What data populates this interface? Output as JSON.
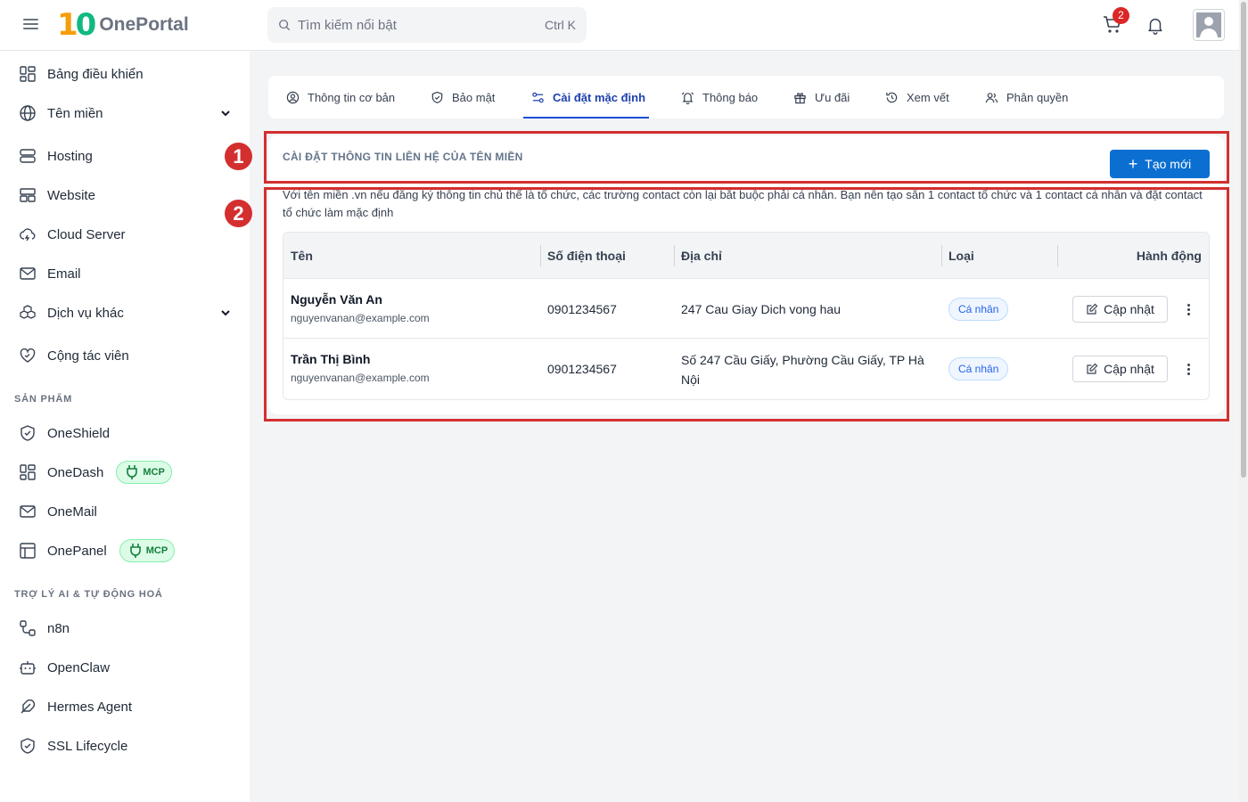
{
  "header": {
    "logo_mark_one": "1",
    "logo_mark_zero": "0",
    "logo_text": "OnePortal",
    "search_placeholder": "Tìm kiếm nổi bật",
    "search_shortcut": "Ctrl K",
    "cart_count": "2"
  },
  "sidebar": {
    "items": [
      {
        "label": "Bảng điều khiển",
        "icon": "dashboard-icon"
      },
      {
        "label": "Tên miền",
        "icon": "globe-icon",
        "expandable": true
      },
      {
        "label": "Hosting",
        "icon": "server-icon"
      },
      {
        "label": "Website",
        "icon": "layout-icon"
      },
      {
        "label": "Cloud Server",
        "icon": "cloud-icon"
      },
      {
        "label": "Email",
        "icon": "mail-icon"
      },
      {
        "label": "Dịch vụ khác",
        "icon": "boxes-icon",
        "expandable": true
      },
      {
        "label": "Cộng tác viên",
        "icon": "handshake-heart-icon"
      }
    ],
    "section_products": "SẢN PHẨM",
    "products": [
      {
        "label": "OneShield",
        "icon": "shield-icon"
      },
      {
        "label": "OneDash",
        "icon": "dashboard-icon",
        "badge": "MCP"
      },
      {
        "label": "OneMail",
        "icon": "mail-icon"
      },
      {
        "label": "OnePanel",
        "icon": "panel-icon",
        "badge": "MCP"
      }
    ],
    "section_ai": "TRỢ LÝ AI & TỰ ĐỘNG HOÁ",
    "ai": [
      {
        "label": "n8n",
        "icon": "workflow-icon"
      },
      {
        "label": "OpenClaw",
        "icon": "bot-icon"
      },
      {
        "label": "Hermes Agent",
        "icon": "feather-icon"
      },
      {
        "label": "SSL Lifecycle",
        "icon": "shield-icon"
      }
    ]
  },
  "tabs": [
    {
      "label": "Thông tin cơ bản",
      "icon": "user-circle-icon"
    },
    {
      "label": "Bảo mật",
      "icon": "shield-check-icon"
    },
    {
      "label": "Cài đặt mặc định",
      "icon": "sliders-icon",
      "active": true
    },
    {
      "label": "Thông báo",
      "icon": "bell-ring-icon"
    },
    {
      "label": "Ưu đãi",
      "icon": "gift-icon"
    },
    {
      "label": "Xem vết",
      "icon": "history-icon"
    },
    {
      "label": "Phân quyền",
      "icon": "users-icon"
    }
  ],
  "card": {
    "title": "CÀI ĐẶT THÔNG TIN LIÊN HỆ CỦA TÊN MIỀN",
    "create_label": "Tạo mới",
    "description": "Với tên miền .vn nếu đăng ký thông tin chủ thể là tổ chức, các trường contact còn lại bắt buộc phải cá nhân. Bạn nên tạo sẵn 1 contact tổ chức và 1 contact cá nhân và đặt contact tổ chức làm mặc định",
    "columns": [
      "Tên",
      "Số điện thoại",
      "Địa chỉ",
      "Loại",
      "Hành động"
    ],
    "rows": [
      {
        "name": "Nguyễn Văn An",
        "email": "nguyenvanan@example.com",
        "phone": "0901234567",
        "address": "247 Cau Giay Dich vong hau",
        "type": "Cá nhân",
        "action": "Cập nhật"
      },
      {
        "name": "Trần Thị Bình",
        "email": "nguyenvanan@example.com",
        "phone": "0901234567",
        "address": "Số 247 Cầu Giấy, Phường Cầu Giấy, TP Hà Nội",
        "type": "Cá nhân",
        "action": "Cập nhật"
      }
    ]
  },
  "annotations": [
    "1",
    "2"
  ],
  "colors": {
    "accent": "#0b6fd1",
    "annotation": "#d32f2f",
    "badge_red": "#dc2626",
    "mcp_green": "#15803d"
  }
}
